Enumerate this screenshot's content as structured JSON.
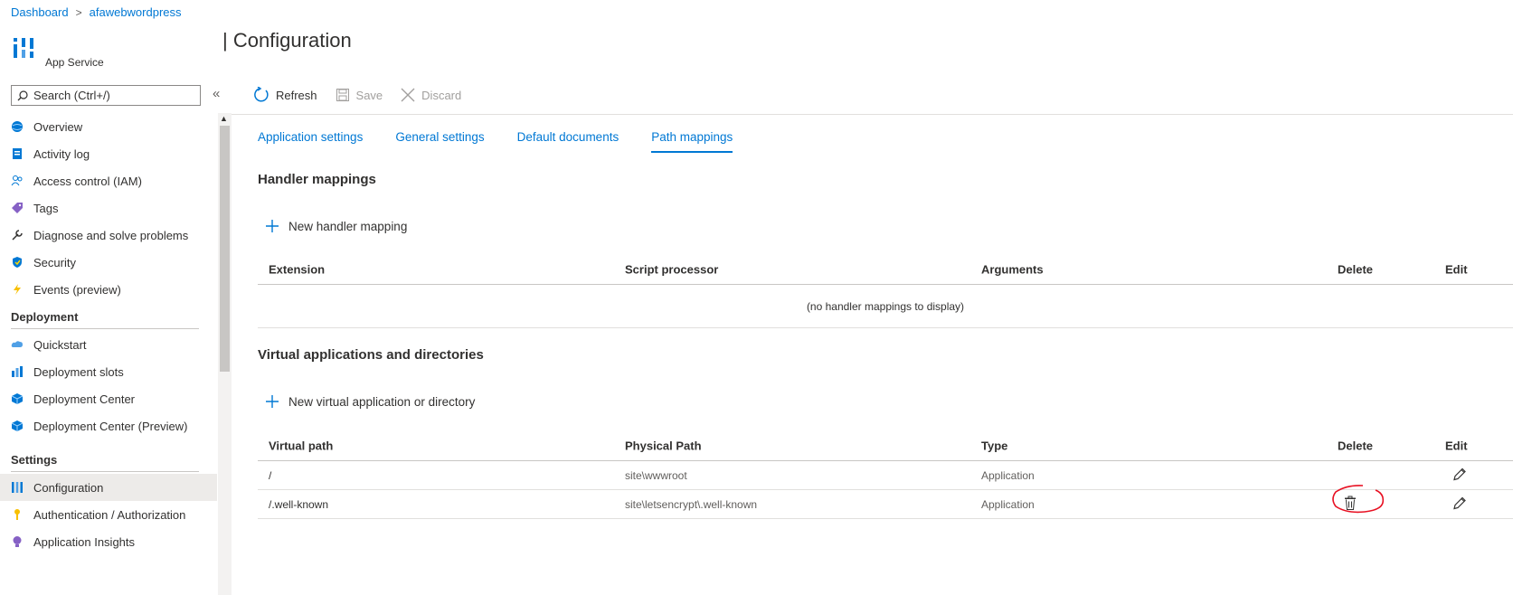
{
  "breadcrumb": {
    "root": "Dashboard",
    "separator": ">",
    "current": "afawebwordpress"
  },
  "app": {
    "subtitle": "App Service",
    "icon": "app-service-icon"
  },
  "page": {
    "title": "| Configuration"
  },
  "search": {
    "placeholder": "Search (Ctrl+/)"
  },
  "collapse_glyph": "«",
  "sidebar": {
    "items": [
      {
        "label": "Overview",
        "icon": "globe-icon"
      },
      {
        "label": "Activity log",
        "icon": "log-icon"
      },
      {
        "label": "Access control (IAM)",
        "icon": "people-icon"
      },
      {
        "label": "Tags",
        "icon": "tag-icon"
      },
      {
        "label": "Diagnose and solve problems",
        "icon": "wrench-icon"
      },
      {
        "label": "Security",
        "icon": "shield-icon"
      },
      {
        "label": "Events (preview)",
        "icon": "lightning-icon"
      }
    ],
    "deployment_header": "Deployment",
    "deployment_items": [
      {
        "label": "Quickstart",
        "icon": "cloud-icon"
      },
      {
        "label": "Deployment slots",
        "icon": "slots-icon"
      },
      {
        "label": "Deployment Center",
        "icon": "cube-icon"
      },
      {
        "label": "Deployment Center (Preview)",
        "icon": "cube-icon"
      }
    ],
    "settings_header": "Settings",
    "settings_items": [
      {
        "label": "Configuration",
        "icon": "config-icon",
        "active": true
      },
      {
        "label": "Authentication / Authorization",
        "icon": "key-icon"
      },
      {
        "label": "Application Insights",
        "icon": "bulb-icon"
      }
    ]
  },
  "toolbar": {
    "refresh": "Refresh",
    "save": "Save",
    "discard": "Discard"
  },
  "tabs": [
    {
      "label": "Application settings"
    },
    {
      "label": "General settings"
    },
    {
      "label": "Default documents"
    },
    {
      "label": "Path mappings",
      "active": true
    }
  ],
  "handler": {
    "title": "Handler mappings",
    "add_label": "New handler mapping",
    "columns": [
      "Extension",
      "Script processor",
      "Arguments",
      "Delete",
      "Edit"
    ],
    "empty": "(no handler mappings to display)"
  },
  "virtual": {
    "title": "Virtual applications and directories",
    "add_label": "New virtual application or directory",
    "columns": [
      "Virtual path",
      "Physical Path",
      "Type",
      "Delete",
      "Edit"
    ],
    "rows": [
      {
        "path": "/",
        "physical": "site\\wwwroot",
        "type": "Application"
      },
      {
        "path": "/.well-known",
        "physical": "site\\letsencrypt\\.well-known",
        "type": "Application"
      }
    ]
  },
  "colors": {
    "accent": "#0078d4",
    "annotation": "#e81123",
    "active_bg": "#edebe9"
  }
}
